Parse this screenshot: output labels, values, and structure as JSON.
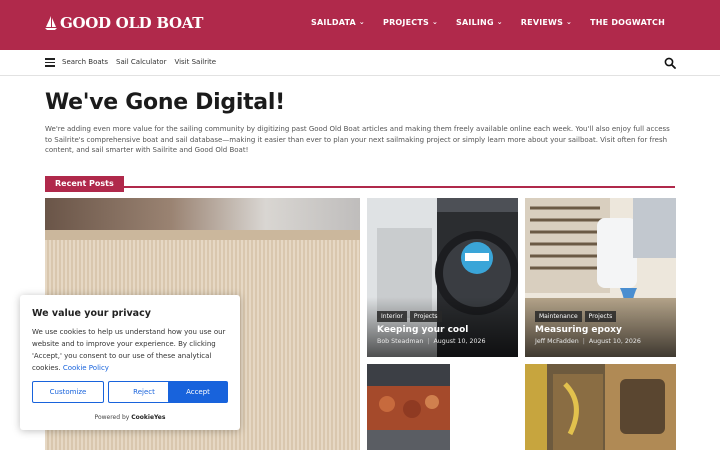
{
  "header": {
    "logo_text": "GOOD OLD BOAT",
    "nav": [
      {
        "label": "SAILDATA",
        "has_dropdown": true
      },
      {
        "label": "PROJECTS",
        "has_dropdown": true
      },
      {
        "label": "SAILING",
        "has_dropdown": true
      },
      {
        "label": "REVIEWS",
        "has_dropdown": true
      },
      {
        "label": "THE DOGWATCH",
        "has_dropdown": false
      }
    ],
    "brand_color": "#b0294b"
  },
  "subnav": {
    "menu_icon": "hamburger-icon",
    "links": [
      "Search Boats",
      "Sail Calculator",
      "Visit Sailrite"
    ],
    "search_icon": "search-icon"
  },
  "main": {
    "title": "We've Gone Digital!",
    "intro": "We're adding even more value for the sailing community by digitizing past Good Old Boat articles and making them freely available online each week. You'll also enjoy full access to Sailrite's comprehensive boat and sail database—making it easier than ever to plan your next sailmaking project or simply learn more about your sailboat. Visit often for fresh content, and sail smarter with Sailrite and Good Old Boat!",
    "section_heading": "Recent Posts"
  },
  "posts": [
    {
      "tags": [
        "Interior",
        "Projects"
      ],
      "title": "Keeping your cool",
      "author": "Bob Steadman",
      "date": "August 10, 2026"
    },
    {
      "tags": [
        "Maintenance",
        "Projects"
      ],
      "title": "Measuring epoxy",
      "author": "Jeff McFadden",
      "date": "August 10, 2026"
    }
  ],
  "cookie_banner": {
    "title": "We value your privacy",
    "body": "We use cookies to help us understand how you use our website and to improve your experience. By clicking 'Accept,' you consent to our use of these analytical cookies.",
    "policy_link": "Cookie Policy",
    "buttons": {
      "customize": "Customize",
      "reject": "Reject",
      "accept": "Accept"
    },
    "powered_prefix": "Powered by",
    "powered_brand": "CookieYes",
    "accent_color": "#1863dc"
  }
}
